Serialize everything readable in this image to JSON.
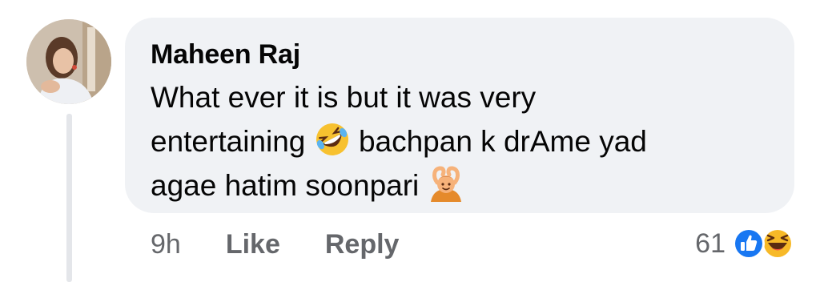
{
  "comment": {
    "author": "Maheen Raj",
    "line1": "What ever it is but it was very",
    "line2_before": "entertaining",
    "line2_after": "bachpan k drAme yad",
    "line3": "agae hatim soonpari",
    "emojis": [
      "rolling-on-floor-laughing-emoji",
      "person-gesturing-ok-emoji"
    ]
  },
  "actions": {
    "time": "9h",
    "like_label": "Like",
    "reply_label": "Reply"
  },
  "reactions": {
    "count": "61",
    "icons": [
      "like-reaction-icon",
      "haha-reaction-icon"
    ],
    "colors": {
      "like": "#1877f2",
      "haha": "#f7b928"
    }
  }
}
